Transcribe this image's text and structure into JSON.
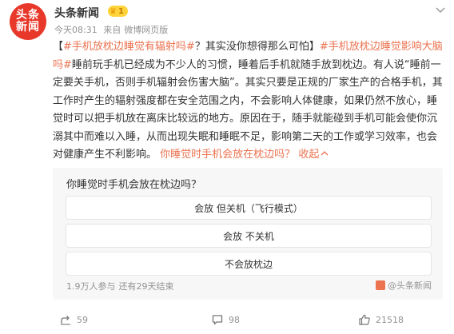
{
  "post": {
    "avatar": {
      "line1": "头条",
      "line2": "新闻"
    },
    "username": "头条新闻",
    "badge_level": "1",
    "time": "今天08:31",
    "source_prefix": "来自",
    "source": "微博网页版",
    "content": {
      "bracket_open": "【",
      "hashtag1": "#手机放枕边睡觉有辐射吗#",
      "text1": "？其实没你想得那么可怕】",
      "hashtag2": "#手机放枕边睡觉影响大脑吗#",
      "body": "睡前玩手机已经成为不少人的习惯，睡着后手机就随手放到枕边。有人说“睡前一定要关手机，否则手机辐射会伤害大脑”。其实只要是正规的厂家生产的合格手机，其工作时产生的辐射强度都在安全范围之内，不会影响人体健康，如果仍然不放心，睡觉时可以把手机放在离床比较远的地方。原因在于，随手就能碰到手机可能会使你沉溺其中而难以入睡，从而出现失眠和睡眠不足，影响第二天的工作或学习效率，也会对健康产生不利影响。",
      "link_text": "你睡觉时手机会放在枕边吗？",
      "collapse_label": "收起"
    }
  },
  "poll": {
    "question": "你睡觉时手机会放在枕边吗？",
    "options": [
      {
        "label": "会放 但关机（飞行模式）"
      },
      {
        "label": "会放 不关机"
      },
      {
        "label": "不会放枕边"
      }
    ],
    "participants": "1.9万人参与",
    "remaining": "还有29天结束",
    "source_name": "@头条新闻"
  },
  "actions": {
    "repost_count": "59",
    "comment_count": "98",
    "like_count": "21518"
  },
  "colors": {
    "accent": "#eb7350",
    "avatar_bg": "#e8382a",
    "badge_bg": "#ffd43b",
    "meta_gray": "#939393",
    "poll_bg": "#f7f7f7"
  },
  "icons": {
    "header_menu": "chevron-down-icon",
    "repost": "repost-icon",
    "comment": "comment-icon",
    "like": "thumbs-up-icon",
    "badge": "crown-icon",
    "poll_source": "source-logo-icon"
  }
}
